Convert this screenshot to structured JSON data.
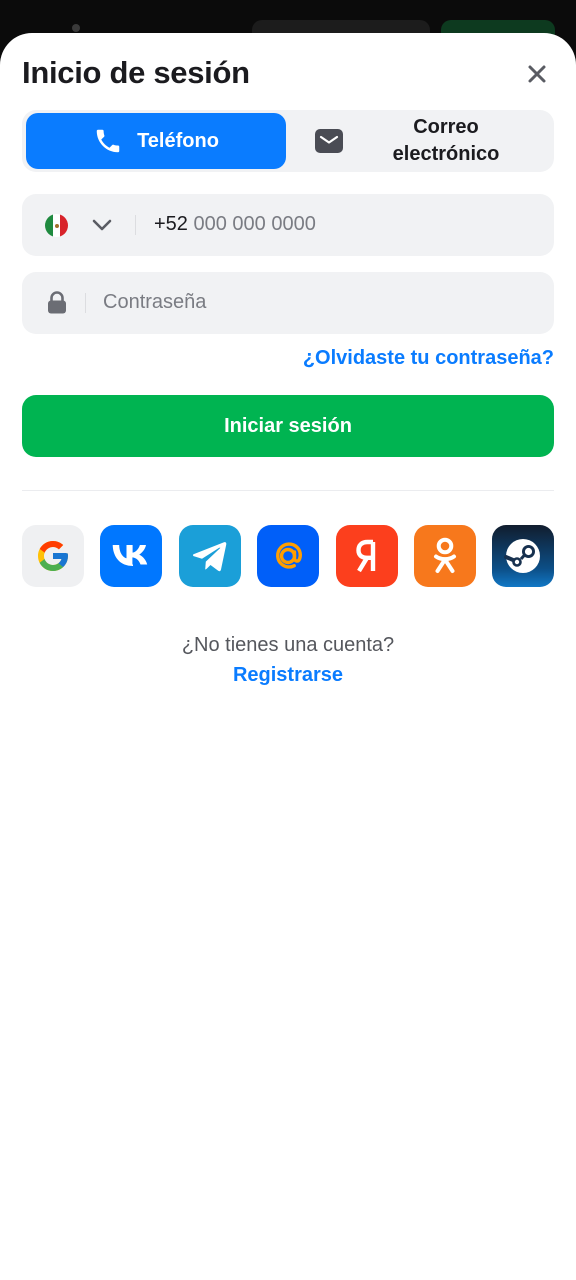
{
  "header": {
    "title": "Inicio de sesión"
  },
  "tabs": {
    "phone_label": "Teléfono",
    "email_label": "Correo electrónico"
  },
  "phone_field": {
    "country_code": "+52",
    "placeholder": "000 000 0000",
    "country_flag": "mexico-flag"
  },
  "password_field": {
    "placeholder": "Contraseña"
  },
  "forgot_link": "¿Olvidaste tu contraseña?",
  "login_button": "Iniciar sesión",
  "socials": [
    "google",
    "vk",
    "telegram",
    "mail-ru",
    "yandex",
    "odnoklassniki",
    "steam"
  ],
  "footer": {
    "no_account": "¿No tienes una cuenta?",
    "register": "Registrarse"
  },
  "colors": {
    "accent": "#0a7cff",
    "primary_button": "#00b451",
    "field_bg": "#f1f2f4"
  }
}
